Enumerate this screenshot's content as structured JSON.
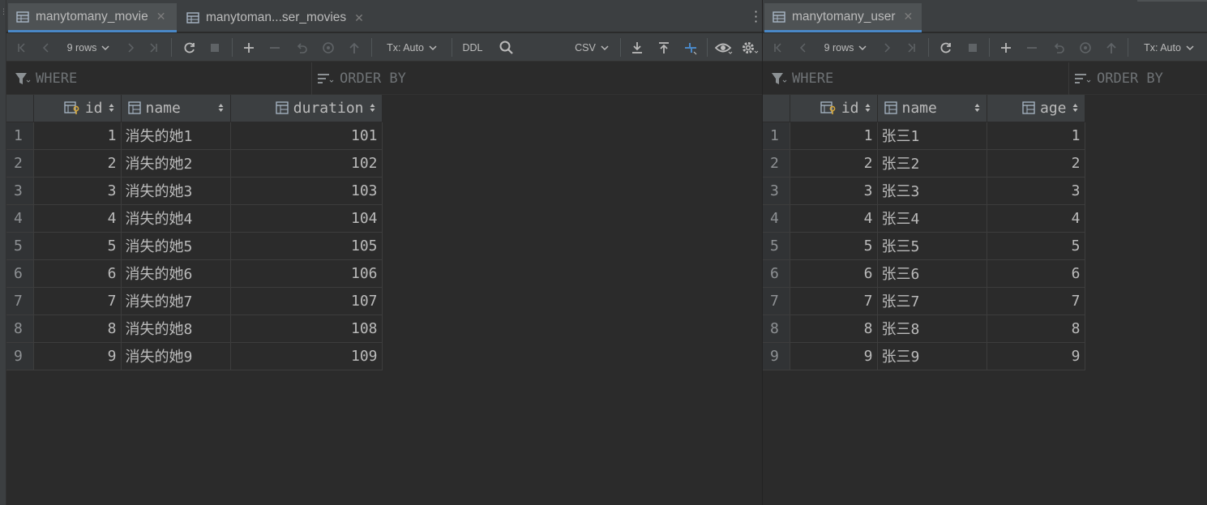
{
  "left": {
    "tabs": [
      {
        "label": "manytomany_movie",
        "active": true
      },
      {
        "label": "manytoman...ser_movies",
        "active": false
      }
    ],
    "toolbar": {
      "rows_label": "9 rows",
      "tx_label": "Tx: Auto",
      "ddl_label": "DDL",
      "export_format": "CSV"
    },
    "filter": {
      "where": "WHERE",
      "order_by": "ORDER BY"
    },
    "columns": [
      {
        "label": "id",
        "key": true
      },
      {
        "label": "name",
        "key": false
      },
      {
        "label": "duration",
        "key": false
      }
    ],
    "rows": [
      {
        "n": "1",
        "id": "1",
        "name": "消失的她1",
        "v": "101"
      },
      {
        "n": "2",
        "id": "2",
        "name": "消失的她2",
        "v": "102"
      },
      {
        "n": "3",
        "id": "3",
        "name": "消失的她3",
        "v": "103"
      },
      {
        "n": "4",
        "id": "4",
        "name": "消失的她4",
        "v": "104"
      },
      {
        "n": "5",
        "id": "5",
        "name": "消失的她5",
        "v": "105"
      },
      {
        "n": "6",
        "id": "6",
        "name": "消失的她6",
        "v": "106"
      },
      {
        "n": "7",
        "id": "7",
        "name": "消失的她7",
        "v": "107"
      },
      {
        "n": "8",
        "id": "8",
        "name": "消失的她8",
        "v": "108"
      },
      {
        "n": "9",
        "id": "9",
        "name": "消失的她9",
        "v": "109"
      }
    ]
  },
  "right": {
    "tabs": [
      {
        "label": "manytomany_user",
        "active": true
      }
    ],
    "toolbar": {
      "rows_label": "9 rows",
      "tx_label": "Tx: Auto"
    },
    "filter": {
      "where": "WHERE",
      "order_by": "ORDER BY"
    },
    "columns": [
      {
        "label": "id",
        "key": true
      },
      {
        "label": "name",
        "key": false
      },
      {
        "label": "age",
        "key": false
      }
    ],
    "rows": [
      {
        "n": "1",
        "id": "1",
        "name": "张三1",
        "v": "1"
      },
      {
        "n": "2",
        "id": "2",
        "name": "张三2",
        "v": "2"
      },
      {
        "n": "3",
        "id": "3",
        "name": "张三3",
        "v": "3"
      },
      {
        "n": "4",
        "id": "4",
        "name": "张三4",
        "v": "4"
      },
      {
        "n": "5",
        "id": "5",
        "name": "张三5",
        "v": "5"
      },
      {
        "n": "6",
        "id": "6",
        "name": "张三6",
        "v": "6"
      },
      {
        "n": "7",
        "id": "7",
        "name": "张三7",
        "v": "7"
      },
      {
        "n": "8",
        "id": "8",
        "name": "张三8",
        "v": "8"
      },
      {
        "n": "9",
        "id": "9",
        "name": "张三9",
        "v": "9"
      }
    ]
  },
  "icons": {
    "table": "table-icon",
    "close": "close-icon",
    "first": "first-page-icon",
    "prev": "previous-page-icon",
    "next": "next-page-icon",
    "last": "last-page-icon",
    "refresh": "refresh-icon",
    "stop": "stop-icon",
    "add": "add-row-icon",
    "remove": "remove-row-icon",
    "revert": "revert-icon",
    "preview": "preview-changes-icon",
    "submit": "submit-icon",
    "search": "search-icon",
    "download": "download-icon",
    "upload": "upload-icon",
    "compare": "compare-icon",
    "view": "eye-icon",
    "settings": "gear-icon",
    "filter": "filter-icon",
    "sort": "sort-icon",
    "more": "more-vertical-icon"
  },
  "colors": {
    "accent": "#4a88c7",
    "key": "#d6a73a",
    "background": "#2b2b2b",
    "chrome": "#3c3f41"
  }
}
